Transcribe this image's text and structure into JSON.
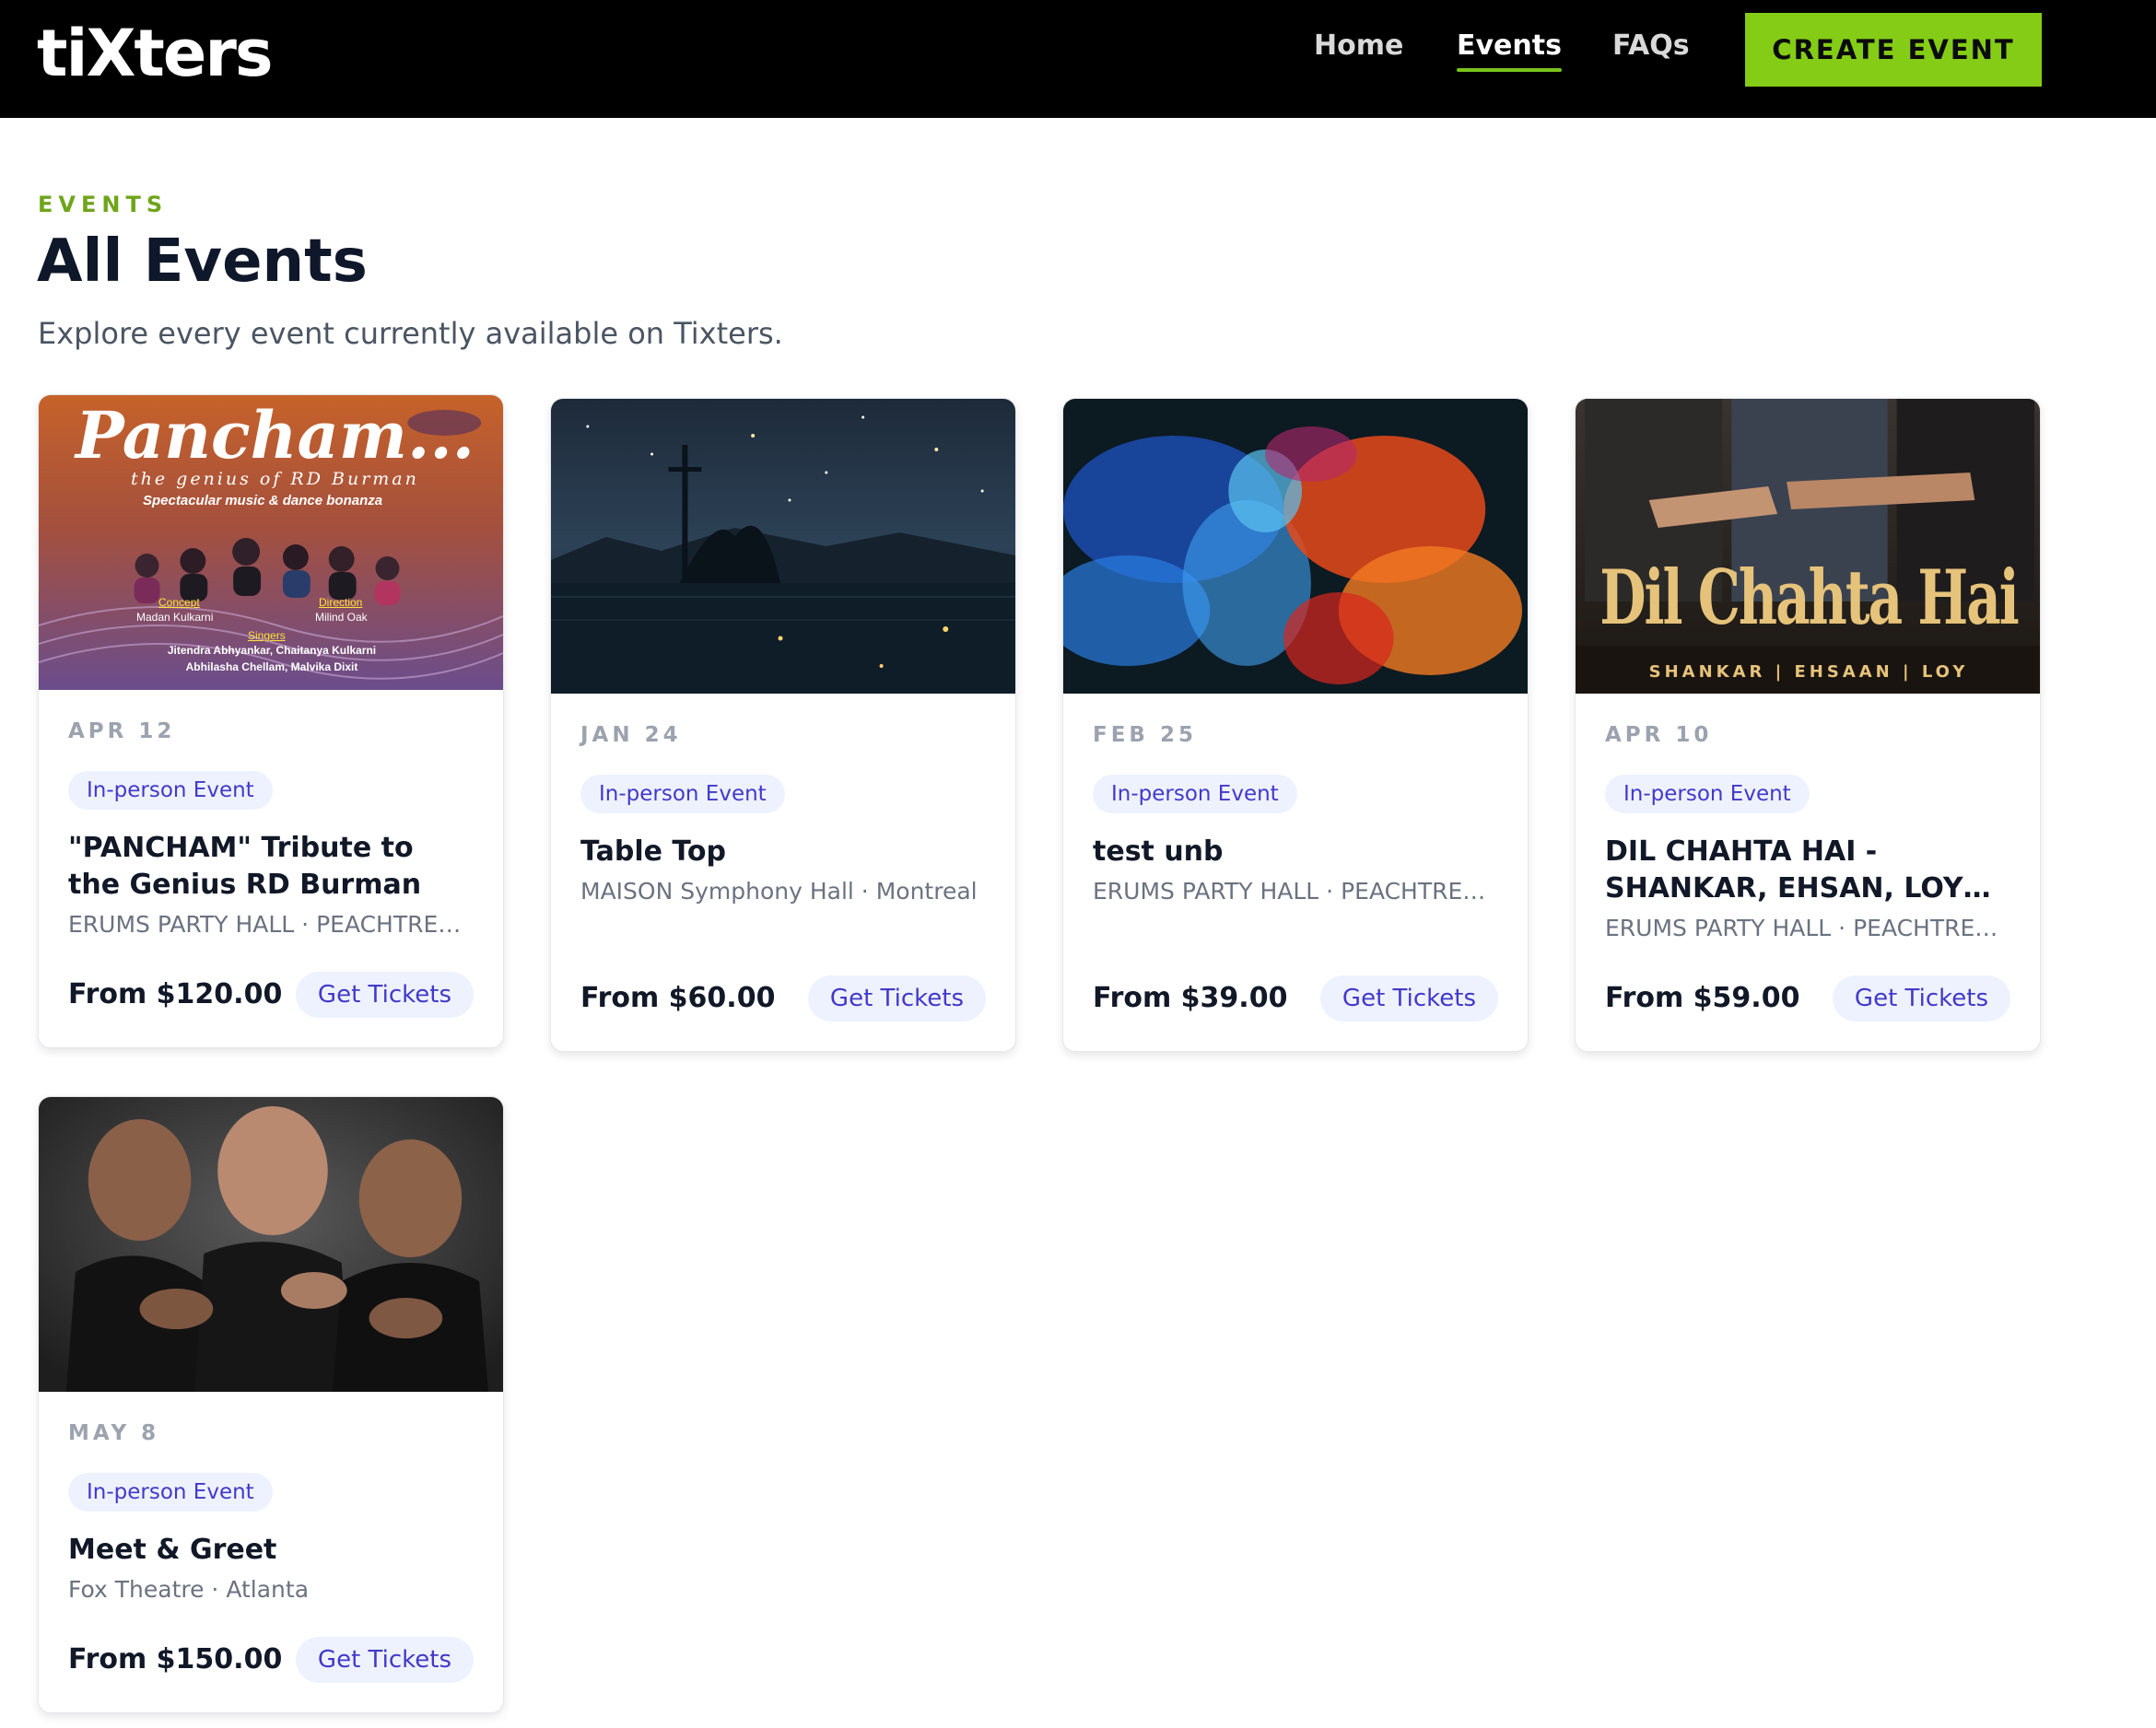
{
  "header": {
    "logo": "tiXters",
    "nav": [
      {
        "label": "Home"
      },
      {
        "label": "Events"
      },
      {
        "label": "FAQs"
      }
    ],
    "create_label": "CREATE EVENT"
  },
  "page": {
    "eyebrow": "EVENTS",
    "title": "All Events",
    "subtitle": "Explore every event currently available on Tixters."
  },
  "events": [
    {
      "date": "APR 12",
      "badge": "In-person Event",
      "title": "\"PANCHAM\" Tribute to the Genius RD Burman",
      "location": "ERUMS PARTY HALL · PEACHTREE ...",
      "price": "From $120.00",
      "cta": "Get Tickets",
      "poster": {
        "headline": "Pancham...",
        "tagline": "the genius of RD Burman",
        "subline": "Spectacular music & dance bonanza",
        "concept_label": "Concept",
        "concept_name": "Madan Kulkarni",
        "direction_label": "Direction",
        "direction_name": "Milind Oak",
        "singers_label": "Singers",
        "singers_line1": "Jitendra Abhyankar, Chaitanya Kulkarni",
        "singers_line2": "Abhilasha Chellam, Malvika Dixit"
      }
    },
    {
      "date": "JAN 24",
      "badge": "In-person Event",
      "title": "Table Top",
      "location": "MAISON Symphony Hall · Montreal",
      "price": "From $60.00",
      "cta": "Get Tickets"
    },
    {
      "date": "FEB 25",
      "badge": "In-person Event",
      "title": "test unb",
      "location": "ERUMS PARTY HALL · PEACHTREE ...",
      "price": "From $39.00",
      "cta": "Get Tickets"
    },
    {
      "date": "APR 10",
      "badge": "In-person Event",
      "title": "DIL CHAHTA HAI - SHANKAR, EHSAN, LOY -...",
      "location": "ERUMS PARTY HALL · PEACHTREE ...",
      "price": "From $59.00",
      "cta": "Get Tickets",
      "poster": {
        "headline": "Dil Chahta Hai",
        "subline": "SHANKAR | EHSAAN | LOY"
      }
    },
    {
      "date": "MAY 8",
      "badge": "In-person Event",
      "title": "Meet & Greet",
      "location": "Fox Theatre · Atlanta",
      "price": "From $150.00",
      "cta": "Get Tickets"
    }
  ],
  "colors": {
    "accent": "#84cc16",
    "badge_bg": "#eef2ff",
    "badge_text": "#4338ca"
  }
}
